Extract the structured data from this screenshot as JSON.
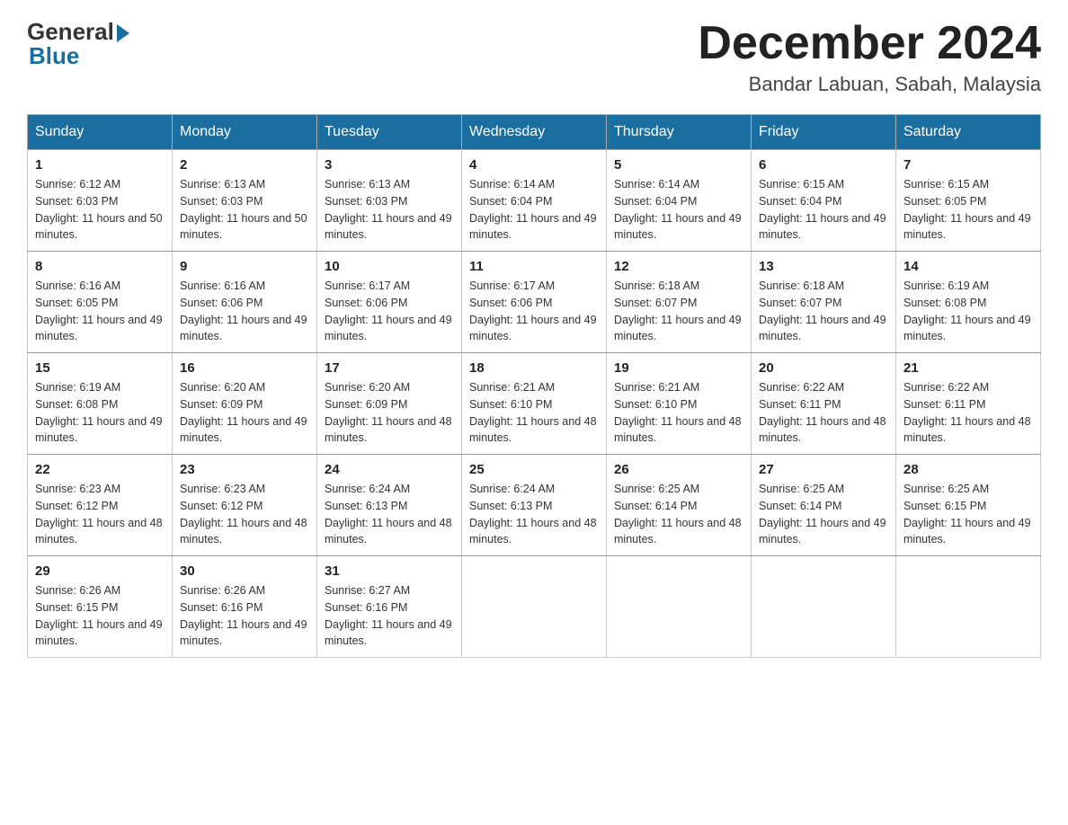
{
  "header": {
    "logo_general": "General",
    "logo_blue": "Blue",
    "month_title": "December 2024",
    "location": "Bandar Labuan, Sabah, Malaysia"
  },
  "weekdays": [
    "Sunday",
    "Monday",
    "Tuesday",
    "Wednesday",
    "Thursday",
    "Friday",
    "Saturday"
  ],
  "weeks": [
    [
      {
        "day": "1",
        "sunrise": "6:12 AM",
        "sunset": "6:03 PM",
        "daylight": "11 hours and 50 minutes."
      },
      {
        "day": "2",
        "sunrise": "6:13 AM",
        "sunset": "6:03 PM",
        "daylight": "11 hours and 50 minutes."
      },
      {
        "day": "3",
        "sunrise": "6:13 AM",
        "sunset": "6:03 PM",
        "daylight": "11 hours and 49 minutes."
      },
      {
        "day": "4",
        "sunrise": "6:14 AM",
        "sunset": "6:04 PM",
        "daylight": "11 hours and 49 minutes."
      },
      {
        "day": "5",
        "sunrise": "6:14 AM",
        "sunset": "6:04 PM",
        "daylight": "11 hours and 49 minutes."
      },
      {
        "day": "6",
        "sunrise": "6:15 AM",
        "sunset": "6:04 PM",
        "daylight": "11 hours and 49 minutes."
      },
      {
        "day": "7",
        "sunrise": "6:15 AM",
        "sunset": "6:05 PM",
        "daylight": "11 hours and 49 minutes."
      }
    ],
    [
      {
        "day": "8",
        "sunrise": "6:16 AM",
        "sunset": "6:05 PM",
        "daylight": "11 hours and 49 minutes."
      },
      {
        "day": "9",
        "sunrise": "6:16 AM",
        "sunset": "6:06 PM",
        "daylight": "11 hours and 49 minutes."
      },
      {
        "day": "10",
        "sunrise": "6:17 AM",
        "sunset": "6:06 PM",
        "daylight": "11 hours and 49 minutes."
      },
      {
        "day": "11",
        "sunrise": "6:17 AM",
        "sunset": "6:06 PM",
        "daylight": "11 hours and 49 minutes."
      },
      {
        "day": "12",
        "sunrise": "6:18 AM",
        "sunset": "6:07 PM",
        "daylight": "11 hours and 49 minutes."
      },
      {
        "day": "13",
        "sunrise": "6:18 AM",
        "sunset": "6:07 PM",
        "daylight": "11 hours and 49 minutes."
      },
      {
        "day": "14",
        "sunrise": "6:19 AM",
        "sunset": "6:08 PM",
        "daylight": "11 hours and 49 minutes."
      }
    ],
    [
      {
        "day": "15",
        "sunrise": "6:19 AM",
        "sunset": "6:08 PM",
        "daylight": "11 hours and 49 minutes."
      },
      {
        "day": "16",
        "sunrise": "6:20 AM",
        "sunset": "6:09 PM",
        "daylight": "11 hours and 49 minutes."
      },
      {
        "day": "17",
        "sunrise": "6:20 AM",
        "sunset": "6:09 PM",
        "daylight": "11 hours and 48 minutes."
      },
      {
        "day": "18",
        "sunrise": "6:21 AM",
        "sunset": "6:10 PM",
        "daylight": "11 hours and 48 minutes."
      },
      {
        "day": "19",
        "sunrise": "6:21 AM",
        "sunset": "6:10 PM",
        "daylight": "11 hours and 48 minutes."
      },
      {
        "day": "20",
        "sunrise": "6:22 AM",
        "sunset": "6:11 PM",
        "daylight": "11 hours and 48 minutes."
      },
      {
        "day": "21",
        "sunrise": "6:22 AM",
        "sunset": "6:11 PM",
        "daylight": "11 hours and 48 minutes."
      }
    ],
    [
      {
        "day": "22",
        "sunrise": "6:23 AM",
        "sunset": "6:12 PM",
        "daylight": "11 hours and 48 minutes."
      },
      {
        "day": "23",
        "sunrise": "6:23 AM",
        "sunset": "6:12 PM",
        "daylight": "11 hours and 48 minutes."
      },
      {
        "day": "24",
        "sunrise": "6:24 AM",
        "sunset": "6:13 PM",
        "daylight": "11 hours and 48 minutes."
      },
      {
        "day": "25",
        "sunrise": "6:24 AM",
        "sunset": "6:13 PM",
        "daylight": "11 hours and 48 minutes."
      },
      {
        "day": "26",
        "sunrise": "6:25 AM",
        "sunset": "6:14 PM",
        "daylight": "11 hours and 48 minutes."
      },
      {
        "day": "27",
        "sunrise": "6:25 AM",
        "sunset": "6:14 PM",
        "daylight": "11 hours and 49 minutes."
      },
      {
        "day": "28",
        "sunrise": "6:25 AM",
        "sunset": "6:15 PM",
        "daylight": "11 hours and 49 minutes."
      }
    ],
    [
      {
        "day": "29",
        "sunrise": "6:26 AM",
        "sunset": "6:15 PM",
        "daylight": "11 hours and 49 minutes."
      },
      {
        "day": "30",
        "sunrise": "6:26 AM",
        "sunset": "6:16 PM",
        "daylight": "11 hours and 49 minutes."
      },
      {
        "day": "31",
        "sunrise": "6:27 AM",
        "sunset": "6:16 PM",
        "daylight": "11 hours and 49 minutes."
      },
      null,
      null,
      null,
      null
    ]
  ],
  "labels": {
    "sunrise": "Sunrise: ",
    "sunset": "Sunset: ",
    "daylight": "Daylight: "
  }
}
